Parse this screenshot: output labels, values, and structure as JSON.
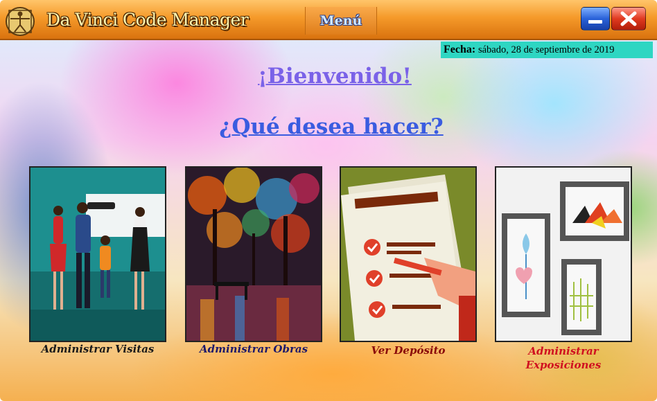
{
  "window": {
    "title": "Da Vinci Code Manager",
    "menu_label": "Menú",
    "logo_icon": "vitruvian-man-icon",
    "minimize_icon": "minimize-icon",
    "close_icon": "close-icon"
  },
  "date": {
    "label": "Fecha:",
    "value": "sábado, 28 de septiembre de 2019"
  },
  "main": {
    "welcome": "¡Bienvenido!",
    "question": "¿Qué desea hacer?"
  },
  "tiles": [
    {
      "label": "Administrar Visitas",
      "icon": "museum-visit-icon",
      "color": "#1a1a1a"
    },
    {
      "label": "Administrar Obras",
      "icon": "painting-icon",
      "color": "#1e1a6a"
    },
    {
      "label": "Ver Depósito",
      "icon": "checklist-icon",
      "color": "#8a0a0a"
    },
    {
      "label": "Administrar Exposiciones",
      "icon": "gallery-wall-icon",
      "color": "#d01020"
    }
  ],
  "colors": {
    "titlebar": "#f59a2a",
    "date_panel": "#2ed6c2",
    "welcome": "#7a62e8",
    "question": "#3a5ce0"
  }
}
